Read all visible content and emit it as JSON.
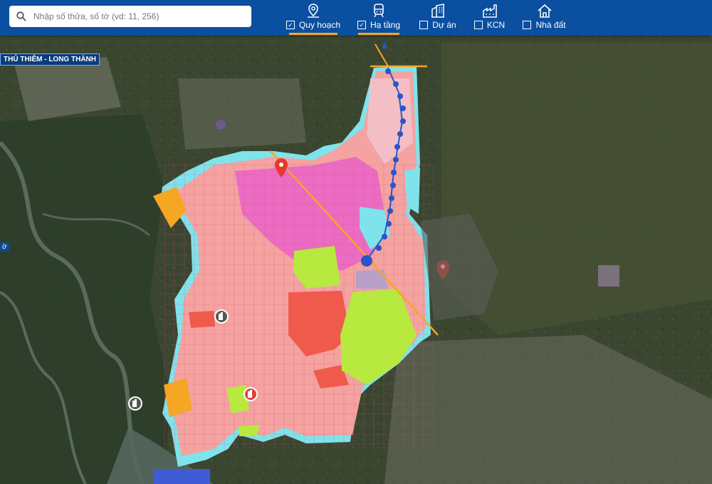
{
  "search": {
    "placeholder": "Nhập số thửa, số tờ (vd: 11, 256)",
    "icon": "search-icon"
  },
  "layers": [
    {
      "label": "Quy hoạch",
      "checked": true,
      "active": true,
      "icon": "map-pin-icon"
    },
    {
      "label": "Hạ tầng",
      "checked": true,
      "active": true,
      "icon": "train-icon"
    },
    {
      "label": "Dự án",
      "checked": false,
      "active": false,
      "icon": "building-icon"
    },
    {
      "label": "KCN",
      "checked": false,
      "active": false,
      "icon": "factory-icon"
    },
    {
      "label": "Nhà đất",
      "checked": false,
      "active": false,
      "icon": "home-icon"
    }
  ],
  "map": {
    "route_label": "THỦ THIÊM - LONG THÀNH",
    "edge_label": "ờ",
    "colors": {
      "residential": "#f4a3a0",
      "mixed": "#e963c8",
      "industrial": "#ef5a4c",
      "green": "#b7e93f",
      "water": "#7fe3ec",
      "transit": "#2a55c8",
      "accent": "#f5a623"
    }
  }
}
